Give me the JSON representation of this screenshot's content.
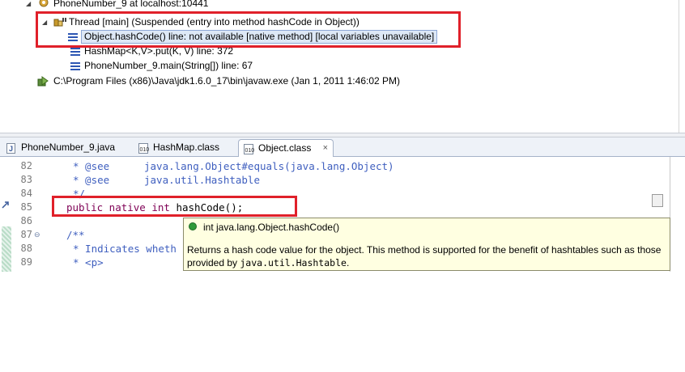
{
  "debug_tree": {
    "target": "PhoneNumber_9 at localhost:10441",
    "thread": "Thread [main] (Suspended (entry into method hashCode in Object))",
    "frames": [
      "Object.hashCode() line: not available [native method] [local variables unavailable]",
      "HashMap<K,V>.put(K, V) line: 372",
      "PhoneNumber_9.main(String[]) line: 67"
    ],
    "process": "C:\\Program Files (x86)\\Java\\jdk1.6.0_17\\bin\\javaw.exe (Jan 1, 2011 1:46:02 PM)"
  },
  "editor_tabs": {
    "tab1": "PhoneNumber_9.java",
    "tab2": "HashMap.class",
    "tab3": "Object.class",
    "close": "×"
  },
  "editor": {
    "line_numbers": [
      "82",
      "83",
      "84",
      "85",
      "86",
      "87",
      "88",
      "89"
    ],
    "fold_marker": "⊖",
    "lines": {
      "l82_tag": "* @see",
      "l82_ref": "java.lang.Object#equals(java.lang.Object)",
      "l83_tag": "* @see",
      "l83_ref": "java.util.Hashtable",
      "l84": "*/",
      "l85_kw": "public native int",
      "l85_rest": " hashCode();",
      "l87": "/**",
      "l88": "* Indicates wheth",
      "l89": "* <p>"
    }
  },
  "hover": {
    "signature": "int java.lang.Object.hashCode()",
    "text_before": "Returns a hash code value for the object. This method is supported for the benefit of hashtables such as those provided by ",
    "code_ref": "java.util.Hashtable",
    "text_after": "."
  },
  "colors": {
    "highlight_box": "#e0202a",
    "keyword": "#7f0055",
    "javadoc": "#3f5fbf",
    "hover_bg": "#ffffe1"
  }
}
